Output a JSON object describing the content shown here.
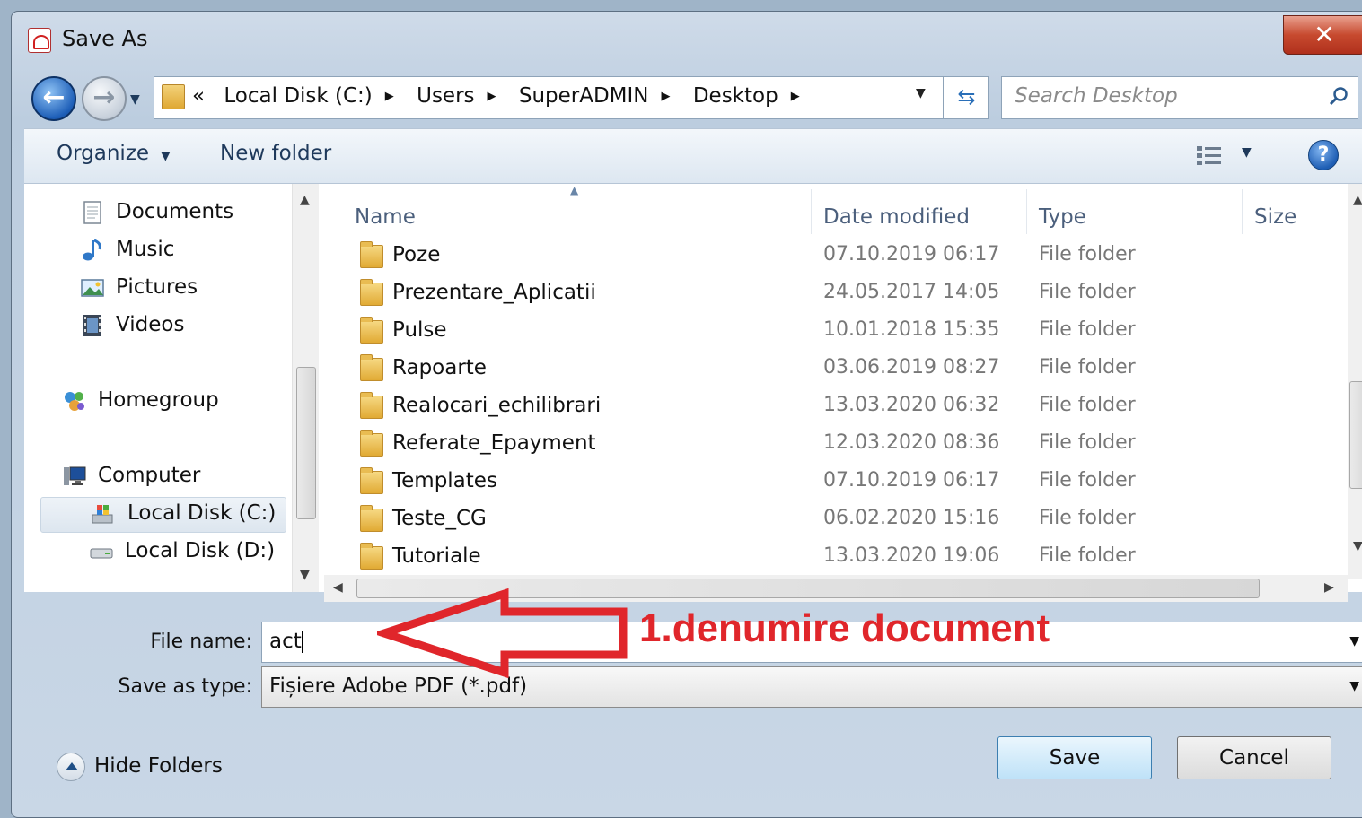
{
  "window": {
    "title": "Save As"
  },
  "nav": {
    "breadcrumbs": [
      "«",
      "Local Disk (C:)",
      "Users",
      "SuperADMIN",
      "Desktop"
    ],
    "search_placeholder": "Search Desktop"
  },
  "toolbar": {
    "organize_label": "Organize",
    "new_folder_label": "New folder"
  },
  "sidebar": {
    "items": [
      {
        "label": "Documents",
        "icon": "documents-icon"
      },
      {
        "label": "Music",
        "icon": "music-icon"
      },
      {
        "label": "Pictures",
        "icon": "pictures-icon"
      },
      {
        "label": "Videos",
        "icon": "videos-icon"
      },
      {
        "label": "Homegroup",
        "icon": "homegroup-icon"
      },
      {
        "label": "Computer",
        "icon": "computer-icon"
      },
      {
        "label": "Local Disk (C:)",
        "icon": "local-disk-icon",
        "selected": true
      },
      {
        "label": "Local Disk (D:)",
        "icon": "drive-icon"
      }
    ]
  },
  "files": {
    "columns": [
      "Name",
      "Date modified",
      "Type",
      "Size"
    ],
    "rows": [
      {
        "name": "Poze",
        "date": "07.10.2019 06:17",
        "type": "File folder"
      },
      {
        "name": "Prezentare_Aplicatii",
        "date": "24.05.2017 14:05",
        "type": "File folder"
      },
      {
        "name": "Pulse",
        "date": "10.01.2018 15:35",
        "type": "File folder"
      },
      {
        "name": "Rapoarte",
        "date": "03.06.2019 08:27",
        "type": "File folder"
      },
      {
        "name": "Realocari_echilibrari",
        "date": "13.03.2020 06:32",
        "type": "File folder"
      },
      {
        "name": "Referate_Epayment",
        "date": "12.03.2020 08:36",
        "type": "File folder"
      },
      {
        "name": "Templates",
        "date": "07.10.2019 06:17",
        "type": "File folder"
      },
      {
        "name": "Teste_CG",
        "date": "06.02.2020 15:16",
        "type": "File folder"
      },
      {
        "name": "Tutoriale",
        "date": "13.03.2020 19:06",
        "type": "File folder"
      }
    ]
  },
  "form": {
    "file_name_label": "File name:",
    "file_name_value": "act",
    "save_type_label": "Save as type:",
    "save_type_value": "Fișiere Adobe PDF (*.pdf)"
  },
  "buttons": {
    "save": "Save",
    "cancel": "Cancel",
    "hide_folders": "Hide Folders"
  },
  "annotation": {
    "text": "1.denumire document",
    "color": "#e0262b"
  }
}
